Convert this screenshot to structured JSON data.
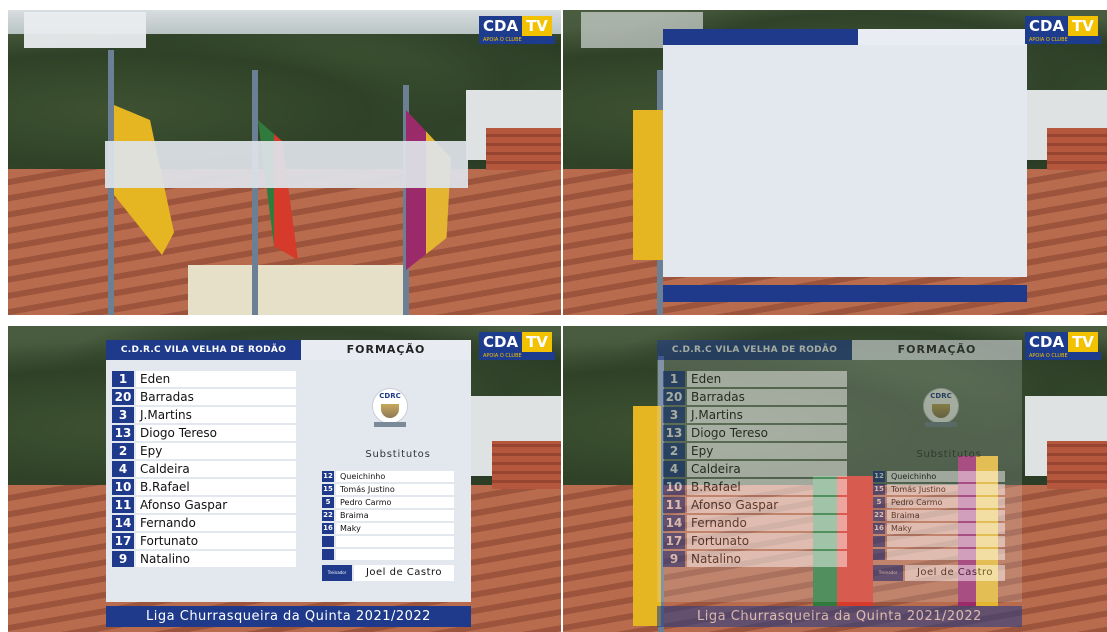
{
  "logo": {
    "cda": "CDA",
    "tv": "TV",
    "sub": "APOIA O CLUBE"
  },
  "lineup": {
    "team_name": "C.D.R.C VILA VELHA DE RODÃO",
    "section_title": "FORMAÇÃO",
    "crest_text": "CDRC",
    "players": [
      {
        "num": "1",
        "name": "Eden"
      },
      {
        "num": "20",
        "name": "Barradas"
      },
      {
        "num": "3",
        "name": "J.Martins"
      },
      {
        "num": "13",
        "name": "Diogo Tereso"
      },
      {
        "num": "2",
        "name": "Epy"
      },
      {
        "num": "4",
        "name": "Caldeira"
      },
      {
        "num": "10",
        "name": "B.Rafael"
      },
      {
        "num": "11",
        "name": "Afonso Gaspar"
      },
      {
        "num": "14",
        "name": "Fernando"
      },
      {
        "num": "17",
        "name": "Fortunato"
      },
      {
        "num": "9",
        "name": "Natalino"
      }
    ],
    "subs_title": "Substitutos",
    "subs": [
      {
        "num": "12",
        "name": "Queichinho"
      },
      {
        "num": "15",
        "name": "Tomás Justino"
      },
      {
        "num": "5",
        "name": "Pedro Carmo"
      },
      {
        "num": "22",
        "name": "Braima"
      },
      {
        "num": "16",
        "name": "Maky"
      },
      {
        "num": "",
        "name": ""
      },
      {
        "num": "",
        "name": ""
      }
    ],
    "coach_label": "Treinador",
    "coach_name": "Joel de Castro",
    "league": "Liga Churrasqueira da Quinta 2021/2022"
  },
  "colors": {
    "navy": "#1f3a8a",
    "panel": "#e3e7ee",
    "logo_yellow": "#f2c200"
  }
}
